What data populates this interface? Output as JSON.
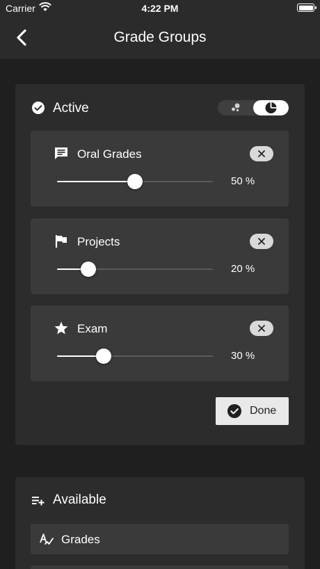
{
  "status_bar": {
    "carrier": "Carrier",
    "time": "4:22 PM"
  },
  "nav": {
    "title": "Grade Groups",
    "back_icon": "chevron-left-icon"
  },
  "active": {
    "title": "Active",
    "icon": "check-circle-icon",
    "toggle": {
      "options": [
        "dots-icon",
        "pie-chart-icon"
      ],
      "selected": "pie-chart-icon"
    },
    "items": [
      {
        "title": "Oral Grades",
        "icon": "comment-icon",
        "percent_label": "50 %",
        "value": 0.5
      },
      {
        "title": "Projects",
        "icon": "flag-icon",
        "percent_label": "20 %",
        "value": 0.2
      },
      {
        "title": "Exam",
        "icon": "star-icon",
        "percent_label": "30 %",
        "value": 0.3
      }
    ],
    "done_label": "Done"
  },
  "available": {
    "title": "Available",
    "icon": "playlist-add-icon",
    "items": [
      {
        "label": "Grades",
        "icon": "handwriting-icon"
      },
      {
        "label": "",
        "icon": ""
      }
    ]
  },
  "colors": {
    "background": "#1f1f1f",
    "card": "#2c2c2c",
    "panel": "#3a3a3a",
    "accent": "#ffffff"
  }
}
